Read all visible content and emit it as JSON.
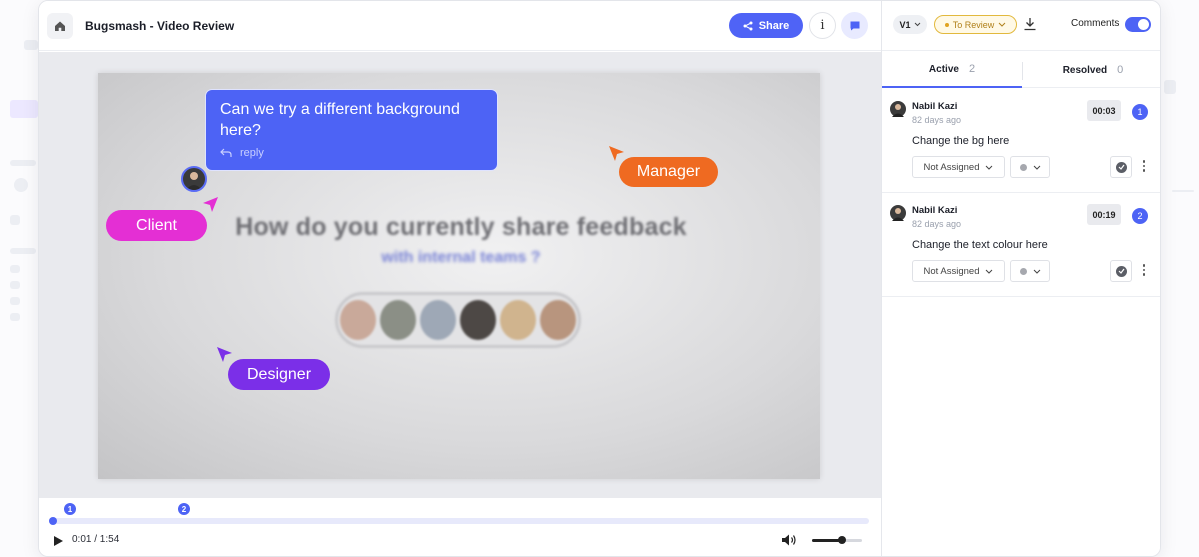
{
  "header": {
    "title": "Bugsmash - Video Review",
    "share_label": "Share",
    "info_label": "i"
  },
  "video": {
    "headline": "How do you currently share feedback",
    "subheadline": "with internal teams ?"
  },
  "comment_bubble": {
    "text": "Can we try a different background here?",
    "reply_label": "reply"
  },
  "role_tags": {
    "manager": "Manager",
    "client": "Client",
    "designer": "Designer"
  },
  "player": {
    "time": "0:01 / 1:54",
    "markers": [
      "1",
      "2"
    ],
    "volume": 0.6
  },
  "panel": {
    "version": "V1",
    "status": "To Review",
    "comments_toggle_label": "Comments",
    "comments_toggle_on": true,
    "tabs": [
      {
        "label": "Active",
        "count": "2"
      },
      {
        "label": "Resolved",
        "count": "0"
      }
    ],
    "comments": [
      {
        "author": "Nabil Kazi",
        "time_ago": "82 days ago",
        "timestamp": "00:03",
        "number": "1",
        "text": "Change the bg here",
        "assignee": "Not Assigned"
      },
      {
        "author": "Nabil Kazi",
        "time_ago": "82 days ago",
        "timestamp": "00:19",
        "number": "2",
        "text": "Change the text colour here",
        "assignee": "Not Assigned"
      }
    ]
  },
  "colors": {
    "accent": "#4d63f5",
    "manager": "#ef6a21",
    "client": "#e42fd4",
    "designer": "#7b2fe8",
    "status": "#e2b93d"
  }
}
